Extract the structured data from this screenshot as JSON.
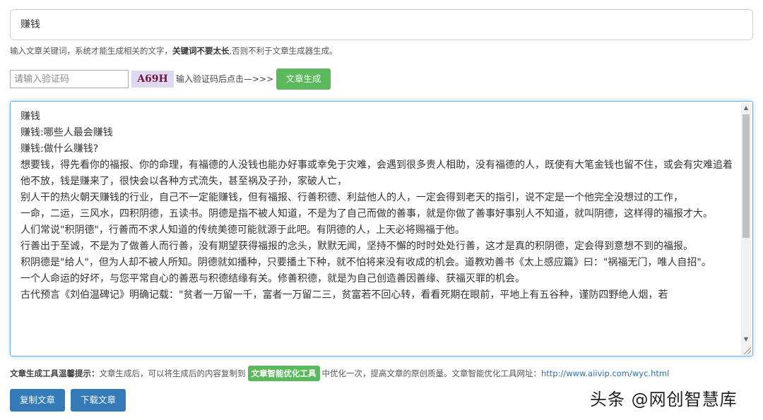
{
  "keyword": {
    "value": "赚钱"
  },
  "keyword_hint": {
    "part1": "输入文章关键词，系统才能生成相关的文字，",
    "bold": "关键词不要太长",
    "part2": ",否则不利于文章生成器生成。"
  },
  "captcha": {
    "placeholder": "请输入验证码",
    "code": "A69H",
    "tip": "输入验证码后点击—>>>",
    "generate_label": "文章生成"
  },
  "article": {
    "lines": [
      "赚钱",
      "赚钱:哪些人最会赚钱",
      "赚钱:做什么赚钱?",
      "想要钱，得先看你的福报、你的命理，有福德的人没钱也能办好事或幸免于灾难，会遇到很多贵人相助，没有福德的人，既使有大笔金钱也留不住，或会有灾难追着他不放，钱是赚来了，很快会以各种方式流失，甚至祸及子孙，家破人亡，",
      "别人干的热火朝天赚钱的行业，自己不一定能赚钱，但有福报、行善积德、利益他人的人，一定会得到老天的指引，说不定是一个他完全没想过的工作，",
      "一命，二运，三风水，四积阴德，五读书。阴德是指不被人知道，不是为了自己而做的善事，就是你做了善事好事别人不知道，就叫阴德，这样得的福报才大。",
      "人们常说\"积阴德\"，行善而不求人知道的传统美德可能就源于此吧。有阴德的人，上天必将赐福于他。",
      "行善出于至诚，不是为了做善人而行善，没有期望获得福报的念头，默默无闻，坚持不懈的时时处处行善，这才是真的积阴德，定会得到意想不到的福报。",
      "积阴德是\"给人\"，但为人却不被人所知。阴德就如播种，只要播土下种，就不怕将来没有收成的机会。道教劝善书《太上感应篇》曰：\"祸福无门，唯人自招\"。",
      "一个人命运的好坏，与您平常自心的善恶与积德结缘有关。修善积德，就是为自己创造善因善缘、获福灭罪的机会。",
      "古代预言《刘伯温碑记》明确记载：\"贫者一万留一千，富者一万留二三，贫富若不回心转，看看死期在眼前，平地上有五谷种，谨防四野绝人烟，若"
    ]
  },
  "tip": {
    "title": "文章生成工具温馨提示：",
    "text1": "文章生成后，可以将生成后的内容复制到",
    "badge": "文章智能优化工具",
    "text2": "中优化一次，提高文章的原创质量。文章智能优化工具网址：",
    "link": "http://www.aiivip.com/wyc.html"
  },
  "buttons": {
    "copy": "复制文章",
    "download": "下载文章"
  },
  "watermark": "头条 @网创智慧库",
  "colors": {
    "green": "#5cb85c",
    "blue": "#337ab7",
    "focus": "#66afe9"
  }
}
